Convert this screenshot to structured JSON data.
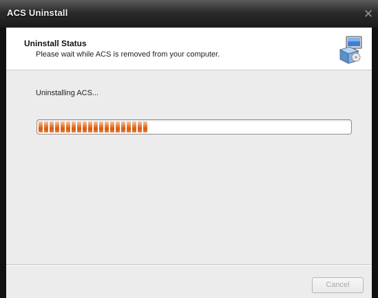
{
  "window": {
    "title": "ACS Uninstall",
    "close_glyph": "×"
  },
  "header": {
    "title": "Uninstall Status",
    "subtitle": "Please wait while ACS is removed from your computer.",
    "icon": "installer-computer-icon"
  },
  "main": {
    "status_text": "Uninstalling ACS...",
    "progress_fraction": 0.35
  },
  "footer": {
    "cancel_label": "Cancel",
    "cancel_enabled": false
  },
  "colors": {
    "progress_orange": "#e26d24",
    "title_bar": "#1a1a1a"
  }
}
